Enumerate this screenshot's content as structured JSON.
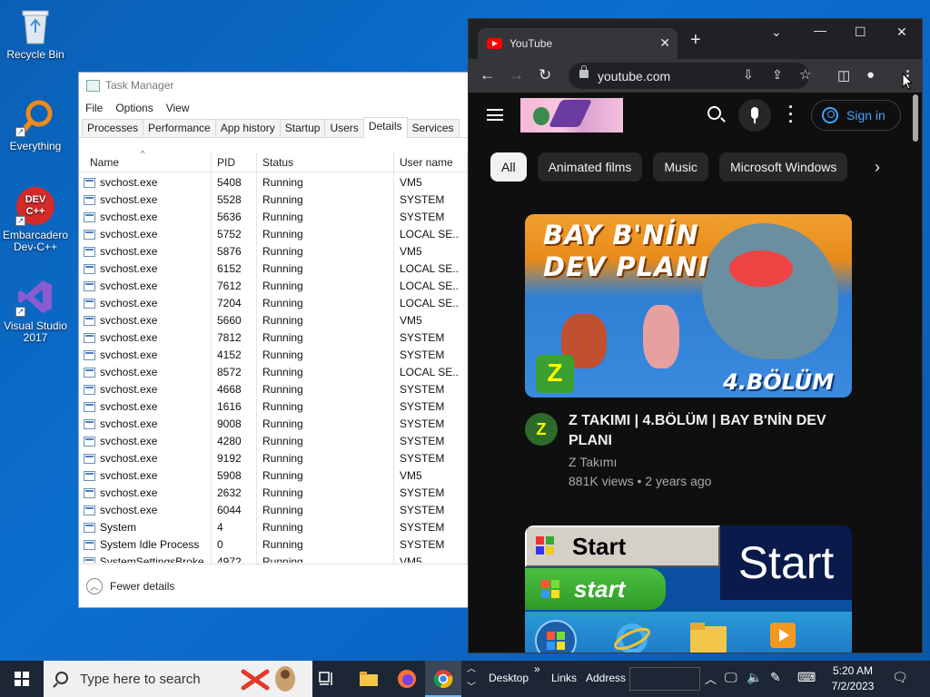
{
  "desktop": {
    "icons": [
      {
        "label": "Recycle Bin"
      },
      {
        "label": "Everything"
      },
      {
        "label": "Embarcadero Dev-C++"
      },
      {
        "label": "Visual Studio 2017"
      }
    ],
    "devcpp_text": "DEV C++"
  },
  "task_manager": {
    "title": "Task Manager",
    "menu": [
      "File",
      "Options",
      "View"
    ],
    "tabs": [
      "Processes",
      "Performance",
      "App history",
      "Startup",
      "Users",
      "Details",
      "Services"
    ],
    "active_tab": "Details",
    "columns": [
      "Name",
      "PID",
      "Status",
      "User name"
    ],
    "rows": [
      [
        "svchost.exe",
        "5408",
        "Running",
        "VM5"
      ],
      [
        "svchost.exe",
        "5528",
        "Running",
        "SYSTEM"
      ],
      [
        "svchost.exe",
        "5636",
        "Running",
        "SYSTEM"
      ],
      [
        "svchost.exe",
        "5752",
        "Running",
        "LOCAL SE..."
      ],
      [
        "svchost.exe",
        "5876",
        "Running",
        "VM5"
      ],
      [
        "svchost.exe",
        "6152",
        "Running",
        "LOCAL SE..."
      ],
      [
        "svchost.exe",
        "7612",
        "Running",
        "LOCAL SE..."
      ],
      [
        "svchost.exe",
        "7204",
        "Running",
        "LOCAL SE..."
      ],
      [
        "svchost.exe",
        "5660",
        "Running",
        "VM5"
      ],
      [
        "svchost.exe",
        "7812",
        "Running",
        "SYSTEM"
      ],
      [
        "svchost.exe",
        "4152",
        "Running",
        "SYSTEM"
      ],
      [
        "svchost.exe",
        "8572",
        "Running",
        "LOCAL SE..."
      ],
      [
        "svchost.exe",
        "4668",
        "Running",
        "SYSTEM"
      ],
      [
        "svchost.exe",
        "1616",
        "Running",
        "SYSTEM"
      ],
      [
        "svchost.exe",
        "9008",
        "Running",
        "SYSTEM"
      ],
      [
        "svchost.exe",
        "4280",
        "Running",
        "SYSTEM"
      ],
      [
        "svchost.exe",
        "9192",
        "Running",
        "SYSTEM"
      ],
      [
        "svchost.exe",
        "5908",
        "Running",
        "VM5"
      ],
      [
        "svchost.exe",
        "2632",
        "Running",
        "SYSTEM"
      ],
      [
        "svchost.exe",
        "6044",
        "Running",
        "SYSTEM"
      ],
      [
        "System",
        "4",
        "Running",
        "SYSTEM"
      ],
      [
        "System Idle Process",
        "0",
        "Running",
        "SYSTEM"
      ],
      [
        "SystemSettingsBroke...",
        "4972",
        "Running",
        "VM5"
      ]
    ],
    "footer_label": "Fewer details"
  },
  "browser": {
    "tab_title": "YouTube",
    "url": "youtube.com",
    "window_controls": {
      "chevron": "⌄",
      "minimize": "—",
      "maximize": "☐",
      "close": "✕"
    },
    "youtube": {
      "sign_in": "Sign in",
      "chips": [
        "All",
        "Animated films",
        "Music",
        "Microsoft Windows"
      ],
      "video1": {
        "thumb_line1": "BAY B'NİN",
        "thumb_line2": "DEV PLANI",
        "thumb_badge": "4.BÖLÜM",
        "title": "Z TAKIMI | 4.BÖLÜM | BAY B'NİN DEV PLANI",
        "channel": "Z Takımı",
        "stats": "881K views • 2 years ago"
      },
      "video2": {
        "start_classic": "Start",
        "start_xp": "start",
        "start_big": "Start"
      }
    }
  },
  "taskbar": {
    "search_placeholder": "Type here to search",
    "desktop_label": "Desktop",
    "links_label": "Links",
    "address_label": "Address",
    "time": "5:20 AM",
    "date": "7/2/2023"
  }
}
